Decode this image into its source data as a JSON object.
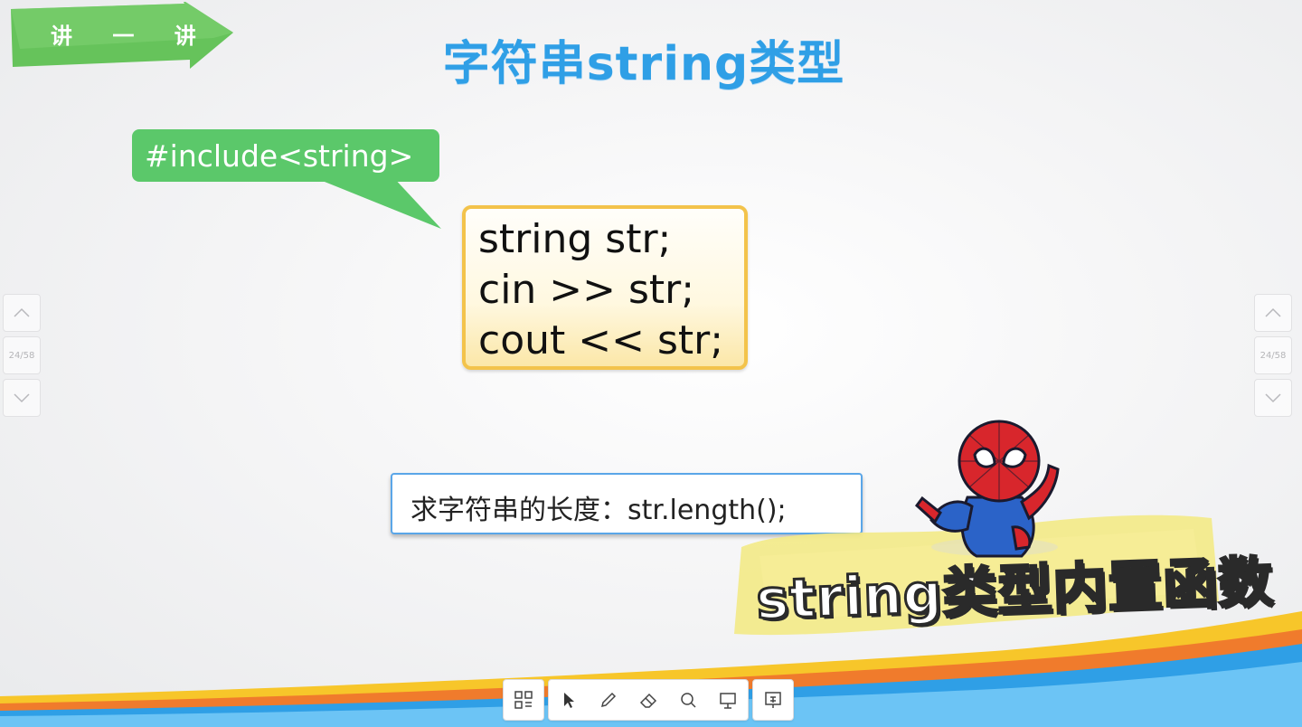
{
  "banner": {
    "label": "讲 一 讲"
  },
  "slide": {
    "title": "字符串string类型",
    "include_label": "#include<string>",
    "code_lines": [
      "string str;",
      "cin >> str;",
      "cout << str;"
    ],
    "length_label": "求字符串的长度：str.length();"
  },
  "sticker": {
    "caption": "string类型内置函数"
  },
  "nav": {
    "page": "24/58"
  },
  "toolbar": {
    "icons": [
      "grid-icon",
      "pointer-icon",
      "pen-icon",
      "eraser-icon",
      "search-icon",
      "screen-icon",
      "presentation-icon"
    ]
  },
  "colors": {
    "title": "#2f9fe6",
    "callout": "#5bc86a",
    "code_border": "#f3c34b",
    "length_border": "#5aa6e8"
  }
}
